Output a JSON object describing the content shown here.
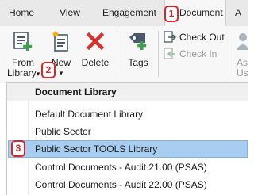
{
  "tabs": [
    {
      "label": "Home"
    },
    {
      "label": "View"
    },
    {
      "label": "Engagement"
    },
    {
      "label": "Document",
      "active": true
    },
    {
      "label": "A"
    }
  ],
  "ribbon": {
    "from_library_line1": "From",
    "from_library_line2": "Library",
    "from_library_caret": "▾",
    "new_label": "New",
    "new_caret": "▾",
    "delete_label": "Delete",
    "tags_label": "Tags",
    "check_out_label": "Check Out",
    "check_in_label": "Check In",
    "partial_label_1": "As",
    "partial_label_2": "Us"
  },
  "menu": {
    "header": "Document Library",
    "items": [
      {
        "label": "Default Document Library"
      },
      {
        "label": "Public Sector"
      },
      {
        "label": "Public Sector TOOLS Library",
        "highlighted": true
      },
      {
        "label": "Control Documents - Audit 21.00 (PSAS)"
      },
      {
        "label": "Control Documents - Audit 22.00 (PSAS)"
      }
    ]
  },
  "callouts": {
    "one": "1",
    "two": "2",
    "three": "3"
  },
  "colors": {
    "callout": "#d9262c",
    "highlight": "#a7cdf0",
    "green_plus": "#3aa34a",
    "delete_red": "#d5312d"
  }
}
